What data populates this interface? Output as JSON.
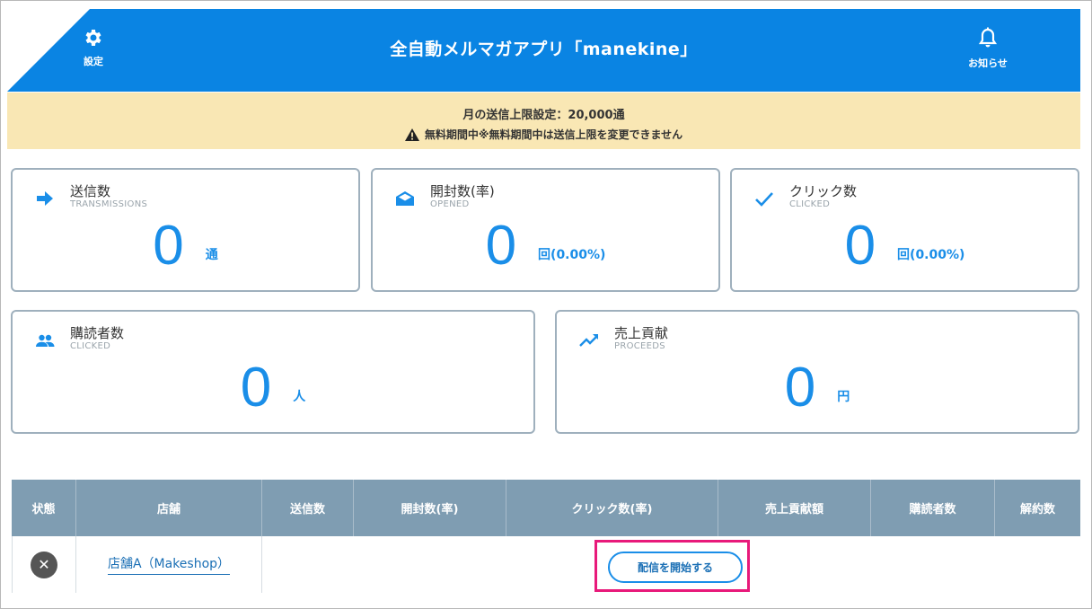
{
  "header": {
    "title": "全自動メルマガアプリ「manekine」",
    "settings_label": "設定",
    "notice_label": "お知らせ",
    "bg_color": "#0a84e3"
  },
  "limit_notice": {
    "line1": "月の送信上限設定：20,000通",
    "line2": "無料期間中※無料期間中は送信上限を変更できません"
  },
  "stats": [
    {
      "label": "送信数",
      "sub": "TRANSMISSIONS",
      "value": "0",
      "unit": "通",
      "icon": "arrow-right-icon"
    },
    {
      "label": "開封数(率)",
      "sub": "OPENED",
      "value": "0",
      "unit": "回(0.00%)",
      "icon": "open-envelope-icon"
    },
    {
      "label": "クリック数",
      "sub": "CLICKED",
      "value": "0",
      "unit": "回(0.00%)",
      "icon": "checkmark-icon"
    },
    {
      "label": "購読者数",
      "sub": "CLICKED",
      "value": "0",
      "unit": "人",
      "icon": "people-icon"
    },
    {
      "label": "売上貢献",
      "sub": "PROCEEDS",
      "value": "0",
      "unit": "円",
      "icon": "trending-up-icon"
    }
  ],
  "table": {
    "headers": [
      "状態",
      "店舗",
      "送信数",
      "開封数(率)",
      "クリック数(率)",
      "売上貢献額",
      "購読者数",
      "解約数"
    ],
    "rows": [
      {
        "status_icon": "close-icon",
        "status_glyph": "✕",
        "shop": "店舗A（Makeshop）",
        "action": "配信を開始する"
      }
    ]
  },
  "colors": {
    "accent": "#1a8ee8",
    "notice_bg": "#f9e7b4",
    "table_header": "#7f9db2",
    "highlight": "#e8197a"
  }
}
